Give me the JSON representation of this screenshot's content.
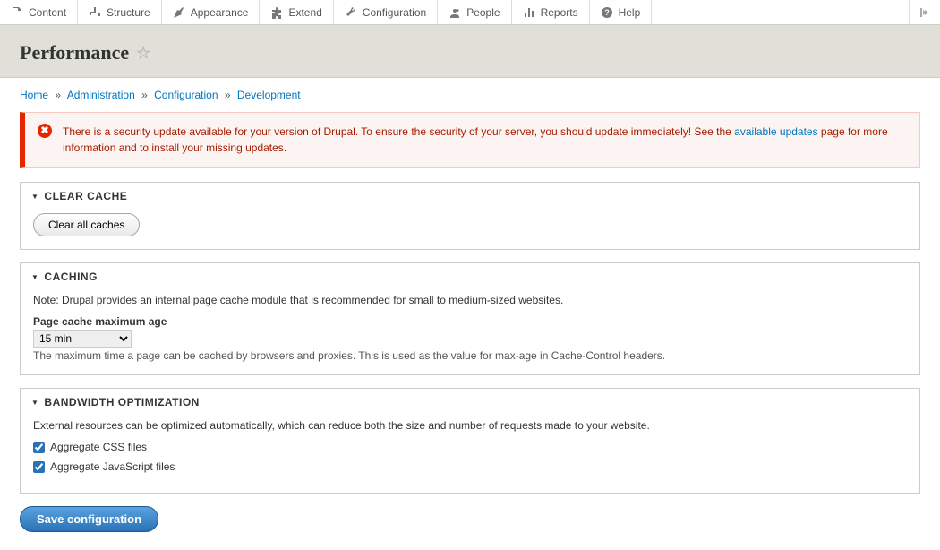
{
  "toolbar": {
    "items": [
      {
        "label": "Content"
      },
      {
        "label": "Structure"
      },
      {
        "label": "Appearance"
      },
      {
        "label": "Extend"
      },
      {
        "label": "Configuration"
      },
      {
        "label": "People"
      },
      {
        "label": "Reports"
      },
      {
        "label": "Help"
      }
    ]
  },
  "page": {
    "title": "Performance"
  },
  "breadcrumb": {
    "home": "Home",
    "admin": "Administration",
    "config": "Configuration",
    "dev": "Development",
    "sep": "»"
  },
  "alert": {
    "prefix": "There is a security update available for your version of Drupal. To ensure the security of your server, you should update immediately! See the ",
    "link": "available updates",
    "suffix": " page for more information and to install your missing updates."
  },
  "sections": {
    "clear_cache": {
      "legend": "CLEAR CACHE",
      "button": "Clear all caches"
    },
    "caching": {
      "legend": "CACHING",
      "note": "Note: Drupal provides an internal page cache module that is recommended for small to medium-sized websites.",
      "field_label": "Page cache maximum age",
      "field_value": "15 min",
      "description": "The maximum time a page can be cached by browsers and proxies. This is used as the value for max-age in Cache-Control headers."
    },
    "bandwidth": {
      "legend": "BANDWIDTH OPTIMIZATION",
      "note": "External resources can be optimized automatically, which can reduce both the size and number of requests made to your website.",
      "css_label": "Aggregate CSS files",
      "js_label": "Aggregate JavaScript files"
    }
  },
  "actions": {
    "save": "Save configuration"
  }
}
